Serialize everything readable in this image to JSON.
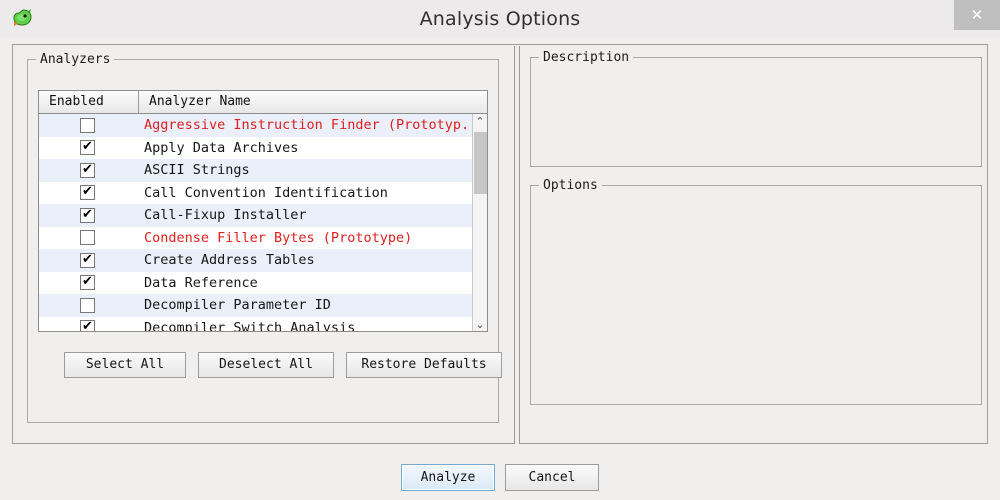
{
  "window": {
    "title": "Analysis Options",
    "icon": "ghidra-dragon-icon",
    "close_label": "✕"
  },
  "analyzers_panel": {
    "group_title": "Analyzers",
    "columns": [
      "Enabled",
      "Analyzer Name"
    ],
    "rows": [
      {
        "name": "Aggressive Instruction Finder (Prototyp..",
        "checked": false,
        "prototype": true
      },
      {
        "name": "Apply Data Archives",
        "checked": true,
        "prototype": false
      },
      {
        "name": "ASCII Strings",
        "checked": true,
        "prototype": false
      },
      {
        "name": "Call Convention Identification",
        "checked": true,
        "prototype": false
      },
      {
        "name": "Call-Fixup Installer",
        "checked": true,
        "prototype": false
      },
      {
        "name": "Condense Filler Bytes (Prototype)",
        "checked": false,
        "prototype": true
      },
      {
        "name": "Create Address Tables",
        "checked": true,
        "prototype": false
      },
      {
        "name": "Data Reference",
        "checked": true,
        "prototype": false
      },
      {
        "name": "Decompiler Parameter ID",
        "checked": false,
        "prototype": false
      },
      {
        "name": "Decompiler Switch Analysis",
        "checked": true,
        "prototype": false
      },
      {
        "name": "",
        "checked": false,
        "prototype": false
      }
    ],
    "buttons": {
      "select_all": "Select All",
      "deselect_all": "Deselect All",
      "restore_defaults": "Restore Defaults"
    },
    "scrollbar": {
      "up_arrow": "⌃",
      "down_arrow": "⌄"
    }
  },
  "description_panel": {
    "group_title": "Description",
    "content": ""
  },
  "options_panel": {
    "group_title": "Options",
    "content": ""
  },
  "footer": {
    "analyze_label": "Analyze",
    "cancel_label": "Cancel"
  },
  "colors": {
    "prototype_text": "#e02020",
    "row_alt": "#eaeffa",
    "accent_focus": "#7aa8d0",
    "window_bg": "#f0efee"
  }
}
